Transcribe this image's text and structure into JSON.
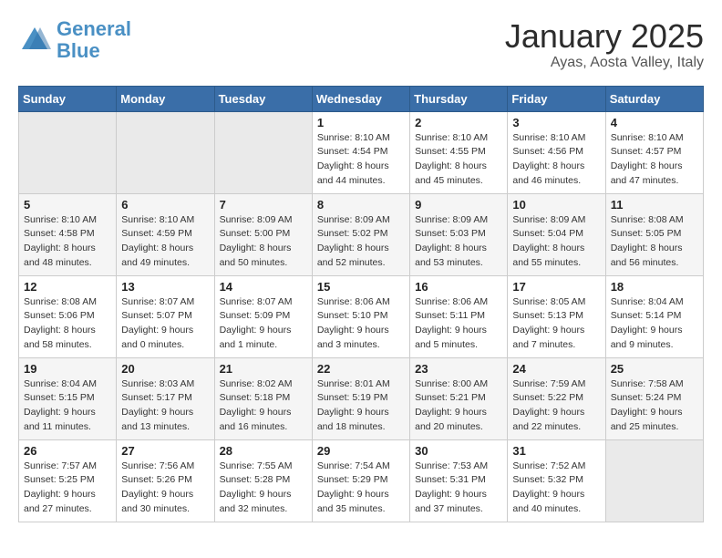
{
  "header": {
    "logo_line1": "General",
    "logo_line2": "Blue",
    "title": "January 2025",
    "subtitle": "Ayas, Aosta Valley, Italy"
  },
  "days_of_week": [
    "Sunday",
    "Monday",
    "Tuesday",
    "Wednesday",
    "Thursday",
    "Friday",
    "Saturday"
  ],
  "weeks": [
    [
      {
        "day": "",
        "info": ""
      },
      {
        "day": "",
        "info": ""
      },
      {
        "day": "",
        "info": ""
      },
      {
        "day": "1",
        "info": "Sunrise: 8:10 AM\nSunset: 4:54 PM\nDaylight: 8 hours\nand 44 minutes."
      },
      {
        "day": "2",
        "info": "Sunrise: 8:10 AM\nSunset: 4:55 PM\nDaylight: 8 hours\nand 45 minutes."
      },
      {
        "day": "3",
        "info": "Sunrise: 8:10 AM\nSunset: 4:56 PM\nDaylight: 8 hours\nand 46 minutes."
      },
      {
        "day": "4",
        "info": "Sunrise: 8:10 AM\nSunset: 4:57 PM\nDaylight: 8 hours\nand 47 minutes."
      }
    ],
    [
      {
        "day": "5",
        "info": "Sunrise: 8:10 AM\nSunset: 4:58 PM\nDaylight: 8 hours\nand 48 minutes."
      },
      {
        "day": "6",
        "info": "Sunrise: 8:10 AM\nSunset: 4:59 PM\nDaylight: 8 hours\nand 49 minutes."
      },
      {
        "day": "7",
        "info": "Sunrise: 8:09 AM\nSunset: 5:00 PM\nDaylight: 8 hours\nand 50 minutes."
      },
      {
        "day": "8",
        "info": "Sunrise: 8:09 AM\nSunset: 5:02 PM\nDaylight: 8 hours\nand 52 minutes."
      },
      {
        "day": "9",
        "info": "Sunrise: 8:09 AM\nSunset: 5:03 PM\nDaylight: 8 hours\nand 53 minutes."
      },
      {
        "day": "10",
        "info": "Sunrise: 8:09 AM\nSunset: 5:04 PM\nDaylight: 8 hours\nand 55 minutes."
      },
      {
        "day": "11",
        "info": "Sunrise: 8:08 AM\nSunset: 5:05 PM\nDaylight: 8 hours\nand 56 minutes."
      }
    ],
    [
      {
        "day": "12",
        "info": "Sunrise: 8:08 AM\nSunset: 5:06 PM\nDaylight: 8 hours\nand 58 minutes."
      },
      {
        "day": "13",
        "info": "Sunrise: 8:07 AM\nSunset: 5:07 PM\nDaylight: 9 hours\nand 0 minutes."
      },
      {
        "day": "14",
        "info": "Sunrise: 8:07 AM\nSunset: 5:09 PM\nDaylight: 9 hours\nand 1 minute."
      },
      {
        "day": "15",
        "info": "Sunrise: 8:06 AM\nSunset: 5:10 PM\nDaylight: 9 hours\nand 3 minutes."
      },
      {
        "day": "16",
        "info": "Sunrise: 8:06 AM\nSunset: 5:11 PM\nDaylight: 9 hours\nand 5 minutes."
      },
      {
        "day": "17",
        "info": "Sunrise: 8:05 AM\nSunset: 5:13 PM\nDaylight: 9 hours\nand 7 minutes."
      },
      {
        "day": "18",
        "info": "Sunrise: 8:04 AM\nSunset: 5:14 PM\nDaylight: 9 hours\nand 9 minutes."
      }
    ],
    [
      {
        "day": "19",
        "info": "Sunrise: 8:04 AM\nSunset: 5:15 PM\nDaylight: 9 hours\nand 11 minutes."
      },
      {
        "day": "20",
        "info": "Sunrise: 8:03 AM\nSunset: 5:17 PM\nDaylight: 9 hours\nand 13 minutes."
      },
      {
        "day": "21",
        "info": "Sunrise: 8:02 AM\nSunset: 5:18 PM\nDaylight: 9 hours\nand 16 minutes."
      },
      {
        "day": "22",
        "info": "Sunrise: 8:01 AM\nSunset: 5:19 PM\nDaylight: 9 hours\nand 18 minutes."
      },
      {
        "day": "23",
        "info": "Sunrise: 8:00 AM\nSunset: 5:21 PM\nDaylight: 9 hours\nand 20 minutes."
      },
      {
        "day": "24",
        "info": "Sunrise: 7:59 AM\nSunset: 5:22 PM\nDaylight: 9 hours\nand 22 minutes."
      },
      {
        "day": "25",
        "info": "Sunrise: 7:58 AM\nSunset: 5:24 PM\nDaylight: 9 hours\nand 25 minutes."
      }
    ],
    [
      {
        "day": "26",
        "info": "Sunrise: 7:57 AM\nSunset: 5:25 PM\nDaylight: 9 hours\nand 27 minutes."
      },
      {
        "day": "27",
        "info": "Sunrise: 7:56 AM\nSunset: 5:26 PM\nDaylight: 9 hours\nand 30 minutes."
      },
      {
        "day": "28",
        "info": "Sunrise: 7:55 AM\nSunset: 5:28 PM\nDaylight: 9 hours\nand 32 minutes."
      },
      {
        "day": "29",
        "info": "Sunrise: 7:54 AM\nSunset: 5:29 PM\nDaylight: 9 hours\nand 35 minutes."
      },
      {
        "day": "30",
        "info": "Sunrise: 7:53 AM\nSunset: 5:31 PM\nDaylight: 9 hours\nand 37 minutes."
      },
      {
        "day": "31",
        "info": "Sunrise: 7:52 AM\nSunset: 5:32 PM\nDaylight: 9 hours\nand 40 minutes."
      },
      {
        "day": "",
        "info": ""
      }
    ]
  ]
}
